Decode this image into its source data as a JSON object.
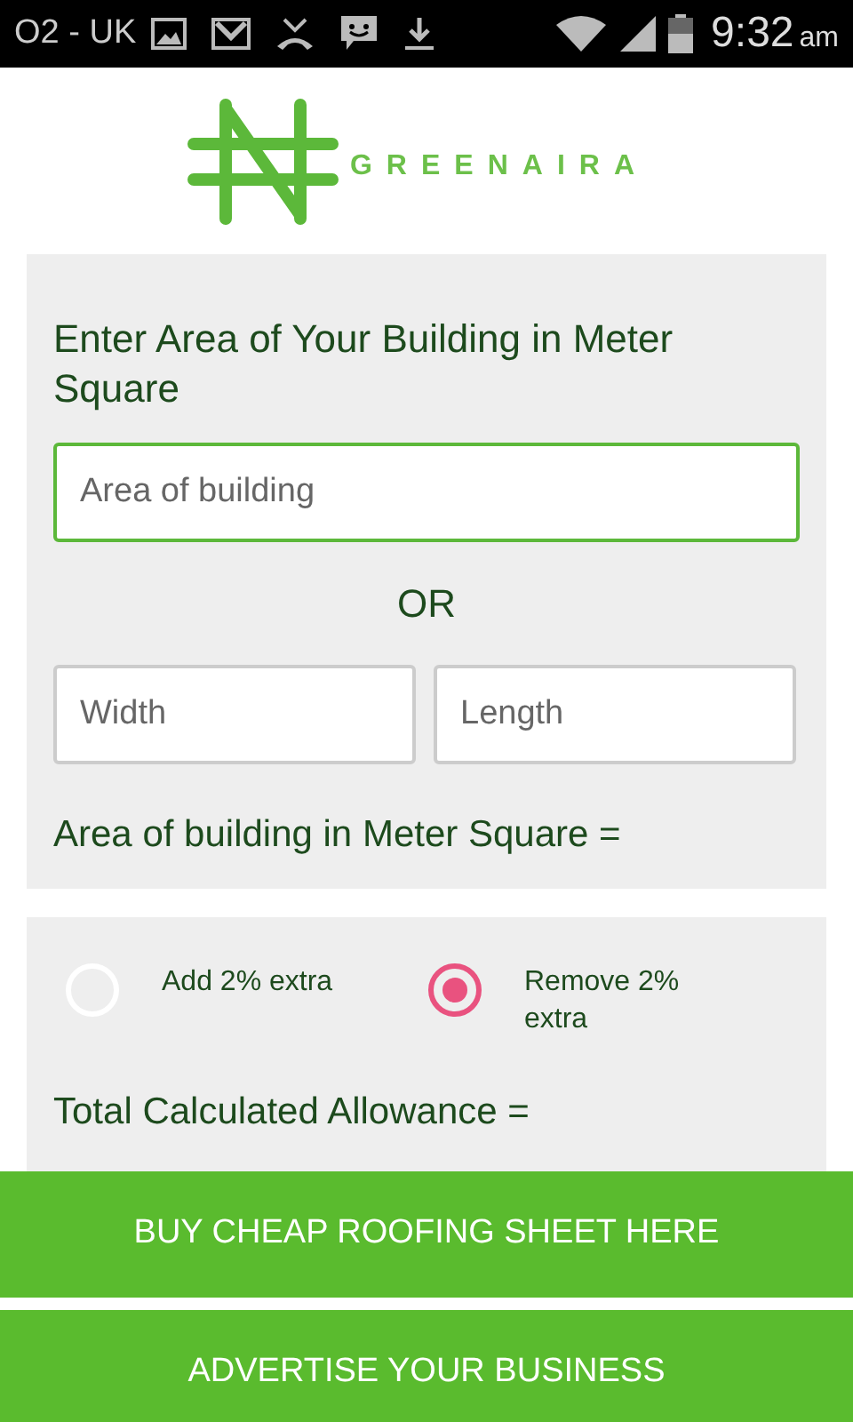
{
  "status_bar": {
    "carrier": "O2 - UK",
    "time": "9:32",
    "time_suffix": "am"
  },
  "logo": {
    "text": "GREENAIRA"
  },
  "area_card": {
    "heading": "Enter Area of Your Building in Meter Square",
    "area_field": {
      "placeholder": "Area of building"
    },
    "separator": "OR",
    "width_field": {
      "placeholder": "Width"
    },
    "length_field": {
      "placeholder": "Length"
    },
    "result_label": "Area of building in Meter Square ="
  },
  "allowance_card": {
    "options": [
      {
        "label": "Add 2% extra",
        "selected": false
      },
      {
        "label": "Remove 2% extra",
        "selected": true
      }
    ],
    "total_label": "Total Calculated Allowance ="
  },
  "buttons": [
    "BUY CHEAP ROOFING SHEET HERE",
    "ADVERTISE YOUR BUSINESS"
  ]
}
